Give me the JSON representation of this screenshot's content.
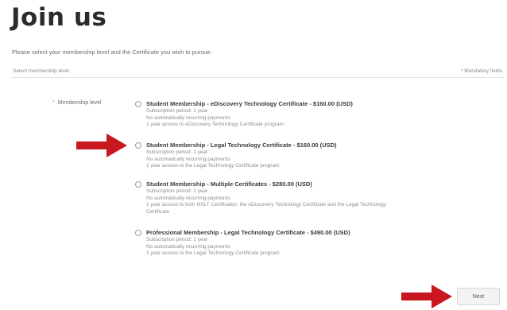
{
  "page": {
    "title": "Join us",
    "subtitle": "Please select your membership level and the Certificate you wish to pursue."
  },
  "section": {
    "label": "Select membership level",
    "mandatory_note": "* Mandatory fields"
  },
  "field": {
    "required_marker": "*",
    "label": "Membership level"
  },
  "options": [
    {
      "title": "Student Membership - eDiscovery Technology Certificate - $160.00 (USD)",
      "lines": [
        "Subscription period: 1 year",
        "No automatically recurring payments",
        "1 year access to eDiscovery Technology Certificate program"
      ]
    },
    {
      "title": "Student Membership - Legal Technology Certificate - $160.00 (USD)",
      "lines": [
        "Subscription period: 1 year",
        "No automatically recurring payments",
        "1 year access to the Legal Technology Certificate program"
      ]
    },
    {
      "title": "Student Membership - Multiple Certificates - $280.00 (USD)",
      "lines": [
        "Subscription period: 1 year",
        "No automatically recurring payments",
        "1 year access to both NSLT Certificates: the eDiscovery Technology Certificate and the Legal Technology",
        "Certificate"
      ]
    },
    {
      "title": "Professional Membership - Legal Technology Certificate - $490.00 (USD)",
      "lines": [
        "Subscription period: 1 year",
        "No automatically recurring payments",
        "1 year access to the Legal Technology Certificate program"
      ]
    }
  ],
  "actions": {
    "next_label": "Next"
  },
  "colors": {
    "arrow": "#c8171e",
    "title": "#2b2b2b"
  }
}
